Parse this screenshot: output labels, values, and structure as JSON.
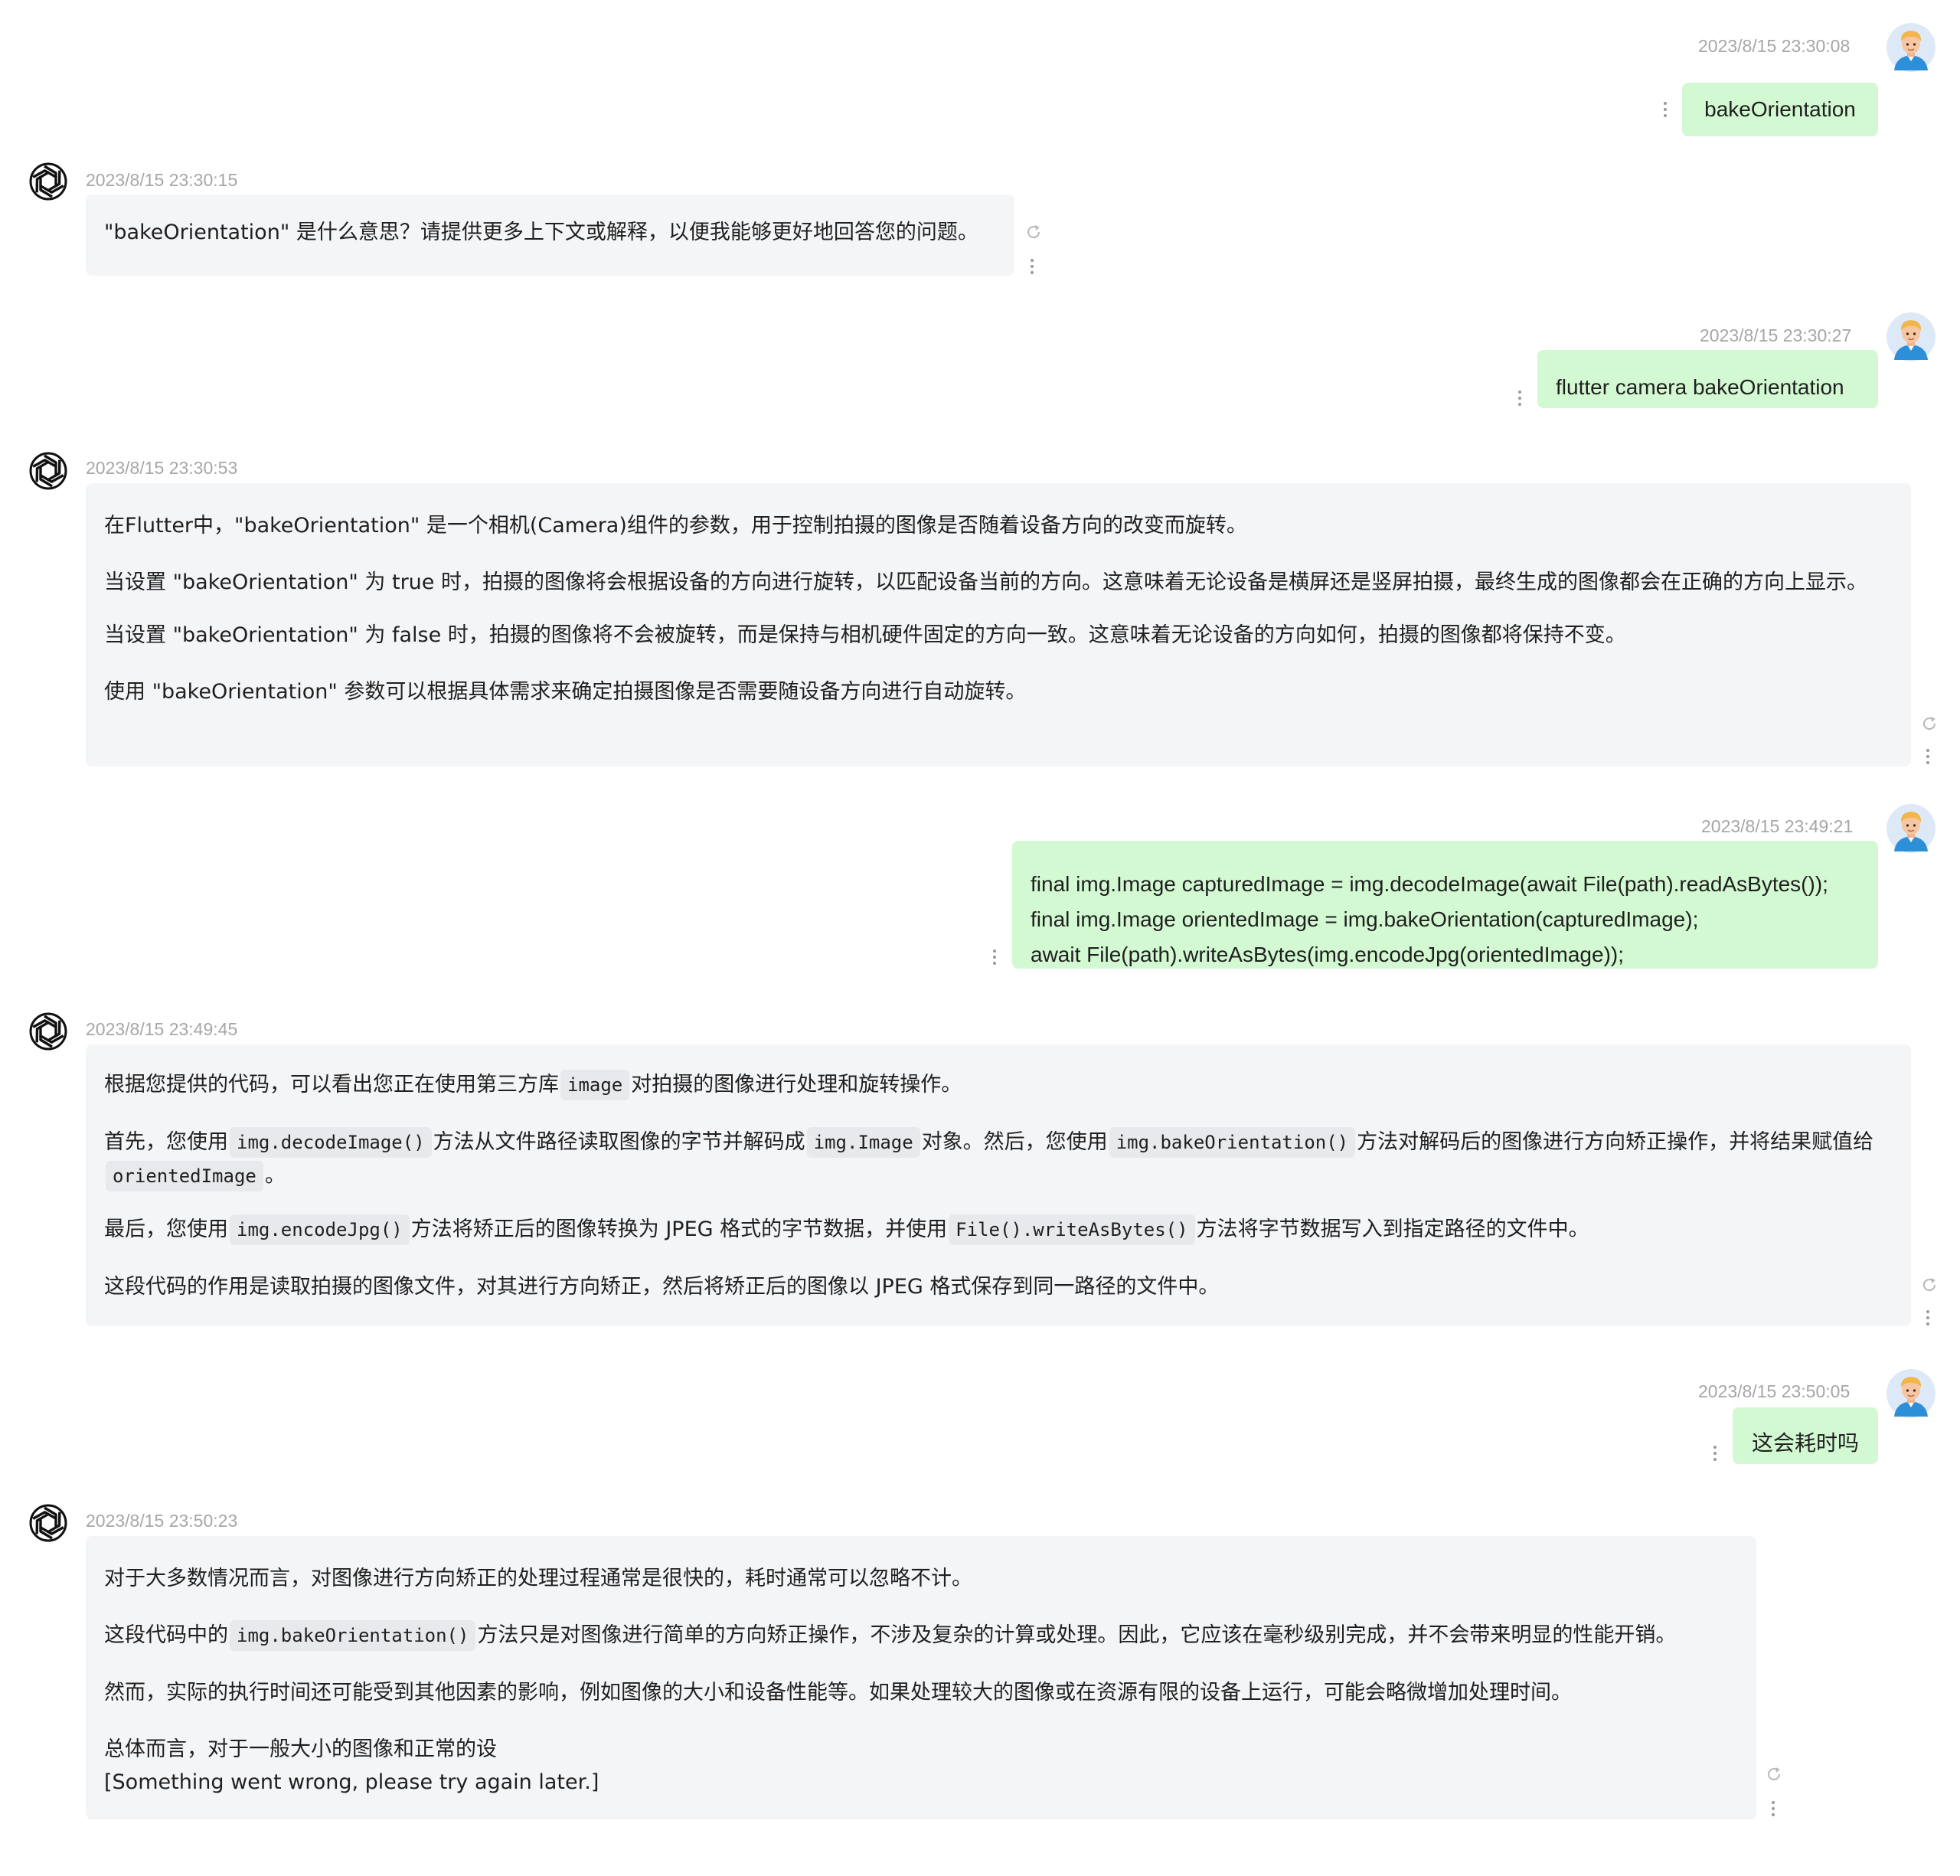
{
  "messages": [
    {
      "role": "user",
      "time": "2023/8/15 23:30:08",
      "text": "bakeOrientation"
    },
    {
      "role": "assistant",
      "time": "2023/8/15 23:30:15",
      "text": "\"bakeOrientation\" 是什么意思？请提供更多上下文或解释，以便我能够更好地回答您的问题。"
    },
    {
      "role": "user",
      "time": "2023/8/15 23:30:27",
      "text": "flutter camera bakeOrientation"
    },
    {
      "role": "assistant",
      "time": "2023/8/15 23:30:53",
      "paragraphs": [
        "在Flutter中，\"bakeOrientation\" 是一个相机(Camera)组件的参数，用于控制拍摄的图像是否随着设备方向的改变而旋转。",
        "当设置 \"bakeOrientation\" 为 true 时，拍摄的图像将会根据设备的方向进行旋转，以匹配设备当前的方向。这意味着无论设备是横屏还是竖屏拍摄，最终生成的图像都会在正确的方向上显示。",
        "当设置 \"bakeOrientation\" 为 false 时，拍摄的图像将不会被旋转，而是保持与相机硬件固定的方向一致。这意味着无论设备的方向如何，拍摄的图像都将保持不变。",
        "使用 \"bakeOrientation\" 参数可以根据具体需求来确定拍摄图像是否需要随设备方向进行自动旋转。"
      ]
    },
    {
      "role": "user",
      "time": "2023/8/15 23:49:21",
      "lines": [
        "final img.Image capturedImage = img.decodeImage(await File(path).readAsBytes());",
        "final img.Image orientedImage = img.bakeOrientation(capturedImage);",
        "await File(path).writeAsBytes(img.encodeJpg(orientedImage));"
      ]
    },
    {
      "role": "assistant",
      "time": "2023/8/15 23:49:45",
      "p1": [
        "根据您提供的代码，可以看出您正在使用第三方库",
        "image",
        "对拍摄的图像进行处理和旋转操作。"
      ],
      "p2": [
        "首先，您使用",
        "img.decodeImage()",
        "方法从文件路径读取图像的字节并解码成",
        "img.Image",
        "对象。然后，您使用",
        "img.bakeOrientation()",
        "方法对解码后的图像进行方向矫正操作，并将结果赋值给",
        "orientedImage",
        "。"
      ],
      "p3": [
        "最后，您使用",
        "img.encodeJpg()",
        "方法将矫正后的图像转换为 JPEG 格式的字节数据，并使用",
        "File().writeAsBytes()",
        "方法将字节数据写入到指定路径的文件中。"
      ],
      "p4": "这段代码的作用是读取拍摄的图像文件，对其进行方向矫正，然后将矫正后的图像以 JPEG 格式保存到同一路径的文件中。"
    },
    {
      "role": "user",
      "time": "2023/8/15 23:50:05",
      "text": "这会耗时吗"
    },
    {
      "role": "assistant",
      "time": "2023/8/15 23:50:23",
      "p1": "对于大多数情况而言，对图像进行方向矫正的处理过程通常是很快的，耗时通常可以忽略不计。",
      "p2": [
        "这段代码中的",
        "img.bakeOrientation()",
        "方法只是对图像进行简单的方向矫正操作，不涉及复杂的计算或处理。因此，它应该在毫秒级别完成，并不会带来明显的性能开销。"
      ],
      "p3": "然而，实际的执行时间还可能受到其他因素的影响，例如图像的大小和设备性能等。如果处理较大的图像或在资源有限的设备上运行，可能会略微增加处理时间。",
      "p4a": "总体而言，对于一般大小的图像和正常的设",
      "p4b": "[Something went wrong, please try again later.]"
    }
  ],
  "icons": {
    "user_avatar": "user-avatar",
    "assistant_logo": "openai-logo-icon",
    "more": "more-vertical-icon",
    "regenerate": "refresh-icon"
  },
  "colors": {
    "user_bubble": "#d2f9d1",
    "assistant_bubble": "#f4f5f7",
    "timestamp": "#a6a6a6"
  }
}
